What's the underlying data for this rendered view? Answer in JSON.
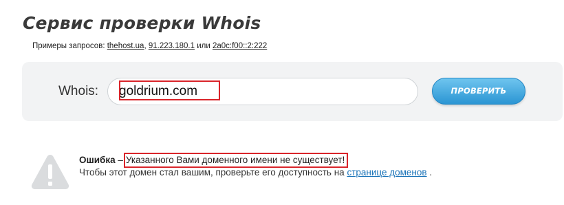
{
  "header": {
    "title": "Сервис проверки Whois"
  },
  "examples": {
    "prefix": "Примеры запросов:",
    "link1": "thehost.ua",
    "sep1": ",",
    "link2": "91.223.180.1",
    "or": "или",
    "link3": "2a0c:f00::2:222"
  },
  "search": {
    "label": "Whois:",
    "value": "goldrium.com",
    "button_label": "ПРОВЕРИТЬ"
  },
  "error": {
    "title": "Ошибка",
    "dash": "–",
    "message": "Указанного Вами доменного имени не существует!",
    "help_text": "Чтобы этот домен стал вашим, проверьте его доступность на",
    "help_link": "странице доменов",
    "help_end": "."
  },
  "colors": {
    "highlight": "#d9242a",
    "button": "#2b95d3",
    "link": "#1a73b8",
    "panel": "#f2f3f4",
    "warning_icon": "#dadcde"
  },
  "icons": {
    "warning": "warning-triangle-icon"
  }
}
